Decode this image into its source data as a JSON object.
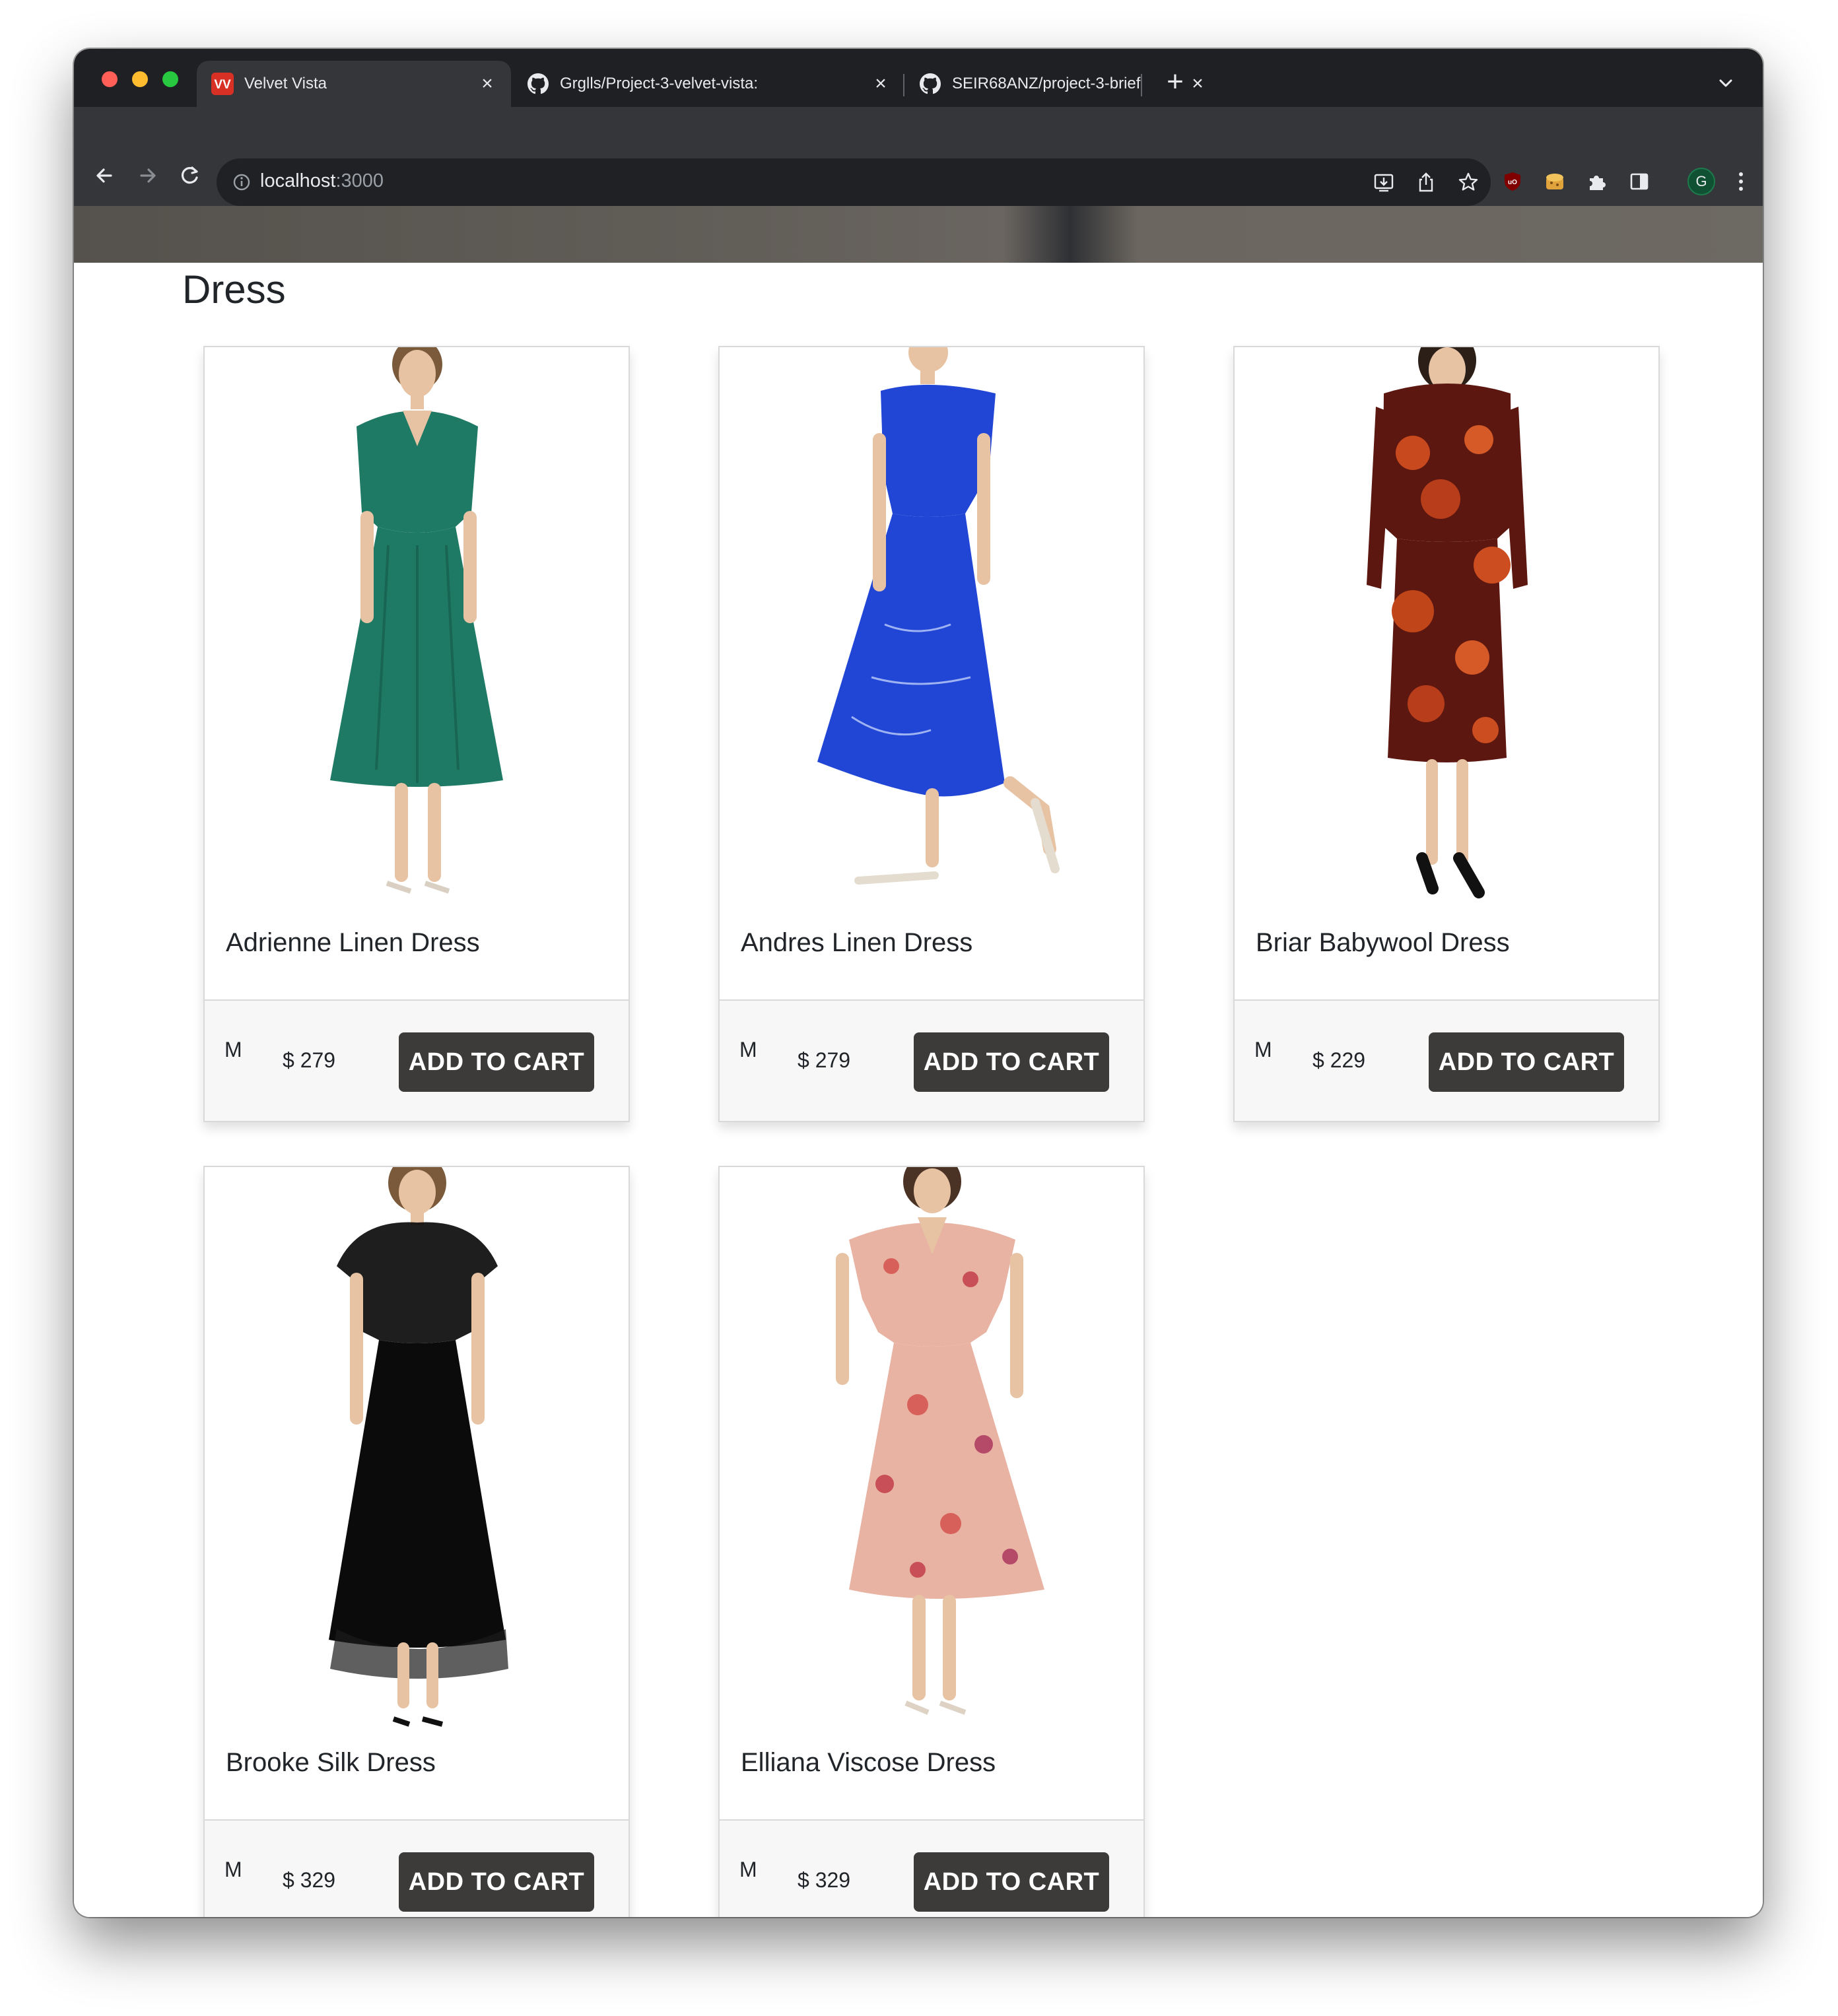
{
  "browser": {
    "tabs": [
      {
        "label": "Velvet Vista",
        "active": true,
        "favicon": "velvet-vista-logo"
      },
      {
        "label": "Grglls/Project-3-velvet-vista:",
        "active": false,
        "favicon": "github-icon"
      },
      {
        "label": "SEIR68ANZ/project-3-brief",
        "active": false,
        "favicon": "github-icon"
      }
    ],
    "favicon_text": "VV",
    "url_host": "localhost",
    "url_port": ":3000",
    "avatar_letter": "G"
  },
  "page": {
    "section_title": "Dress",
    "products": [
      {
        "name": "Adrienne Linen Dress",
        "size": "M",
        "price": "$ 279",
        "button": "ADD TO CART",
        "dress_color": "#1f7a65"
      },
      {
        "name": "Andres Linen Dress",
        "size": "M",
        "price": "$ 279",
        "button": "ADD TO CART",
        "dress_color": "#2146d6"
      },
      {
        "name": "Briar Babywool Dress",
        "size": "M",
        "price": "$ 229",
        "button": "ADD TO CART",
        "dress_color": "#5c1710"
      },
      {
        "name": "Brooke Silk Dress",
        "size": "M",
        "price": "$ 329",
        "button": "ADD TO CART",
        "dress_color": "#0b0b0b"
      },
      {
        "name": "Elliana Viscose Dress",
        "size": "M",
        "price": "$ 329",
        "button": "ADD TO CART",
        "dress_color": "#e9b3a3"
      }
    ]
  }
}
